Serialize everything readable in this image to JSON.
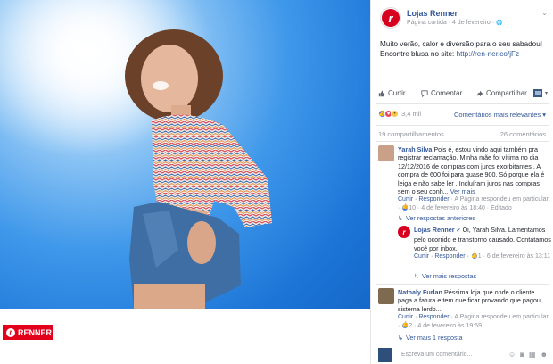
{
  "page": {
    "name": "Lojas Renner",
    "meta": "Página curtida · 4 de fevereiro · ",
    "globe": "🌐"
  },
  "post": {
    "text_line1": "Muito verão, calor e diversão para o seu sabadou!",
    "text_line2_prefix": "Encontre blusa no site: ",
    "link": "http://ren-ner.co/jFz"
  },
  "actions": {
    "like": "Curtir",
    "comment": "Comentar",
    "share": "Compartilhar"
  },
  "reactions": {
    "count": "3,4 mil",
    "sort": "Comentários mais relevantes ▾"
  },
  "stats": {
    "shares": "19 compartilhamentos",
    "comments": "26 comentários"
  },
  "comments": [
    {
      "author": "Yarah Silva",
      "text": "Pois é, estou vindo aqui também pra registrar reclamação. Minha mãe foi vítima no dia 12/12/2016 de compras com juros exorbitantes . A compra de 600 foi para quase 900. Só porque ela é leiga e não sabe ler . Incluíram juros nas compras sem o seu conh...",
      "more": "Ver mais",
      "meta_actions": "Curtir · Responder",
      "meta_text": " · A Página respondeu em particular · ",
      "meta_likes": "10",
      "meta_date": " · 4 de fevereiro às 18:40 · Editado"
    },
    {
      "link": "Ver respostas anteriores"
    },
    {
      "author": "Lojas Renner",
      "text": "Oi, Yarah Silva. Lamentamos pelo ocorrido e transtorno causado. Contatamos você por inbox.",
      "meta_actions": "Curtir · Responder · ",
      "meta_likes": "1",
      "meta_date": " · 6 de fevereiro às 13:11"
    },
    {
      "link": "Ver mais respostas"
    },
    {
      "author": "Nathaly Furlan",
      "text": "Péssima loja que onde o cliente paga a fatura e tem que ficar provando que pagou, sistema lerdo...",
      "meta_actions": "Curtir · Responder",
      "meta_text": " · A Página respondeu em particular · ",
      "meta_likes": "2",
      "meta_date": " · 4 de fevereiro às 19:59"
    },
    {
      "link": "Ver mais 1 resposta"
    }
  ],
  "compose": {
    "placeholder": "Escreva um comentário..."
  },
  "brand": {
    "logo_text": "RENNER",
    "accent": "#e3001b",
    "link_color": "#365899"
  }
}
